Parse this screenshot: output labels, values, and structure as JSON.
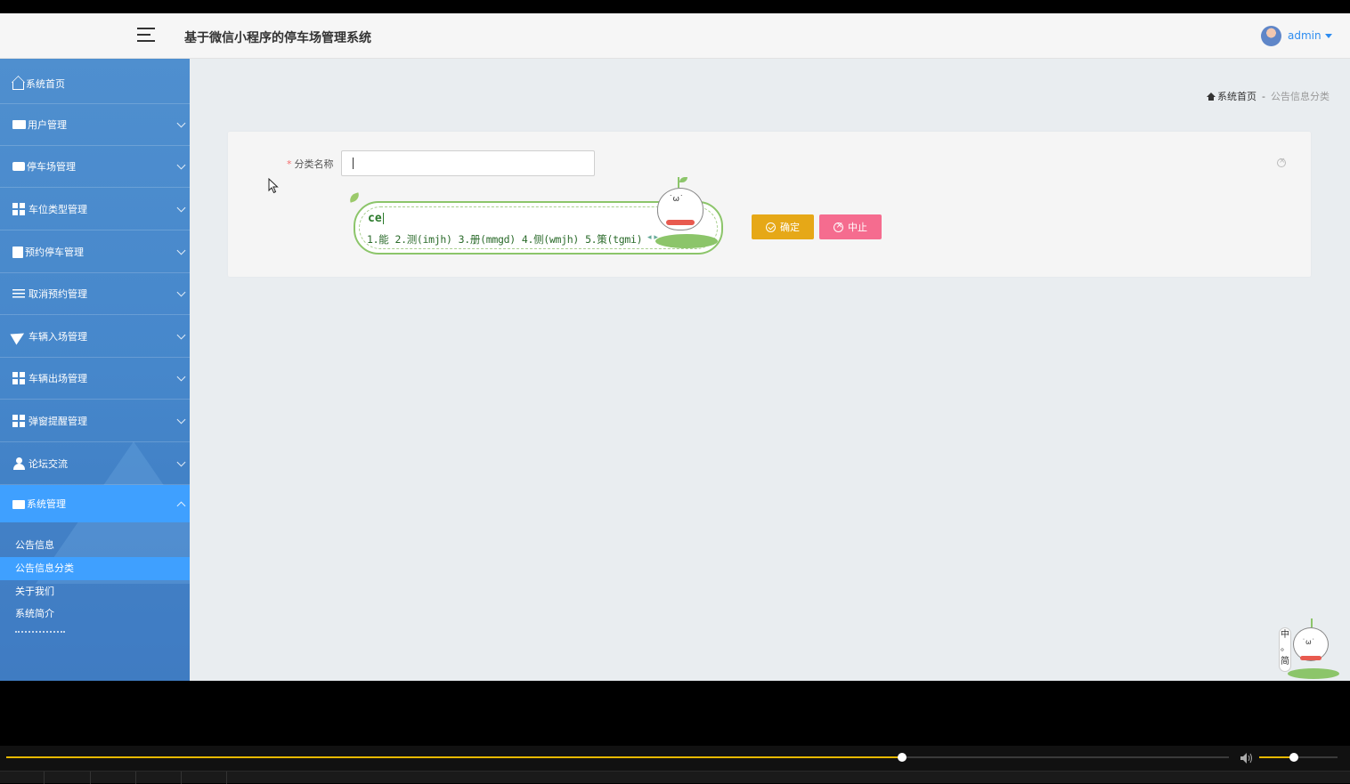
{
  "header": {
    "app_title": "基于微信小程序的停车场管理系统",
    "user_name": "admin"
  },
  "sidebar": {
    "items": [
      {
        "label": "系统首页",
        "icon": "home-icon"
      },
      {
        "label": "用户管理",
        "icon": "ticket-icon"
      },
      {
        "label": "停车场管理",
        "icon": "chat-icon"
      },
      {
        "label": "车位类型管理",
        "icon": "grid-icon"
      },
      {
        "label": "预约停车管理",
        "icon": "clipboard-icon"
      },
      {
        "label": "取消预约管理",
        "icon": "sliders-icon"
      },
      {
        "label": "车辆入场管理",
        "icon": "paper-plane-icon"
      },
      {
        "label": "车辆出场管理",
        "icon": "grid-icon"
      },
      {
        "label": "弹窗提醒管理",
        "icon": "grid-icon"
      },
      {
        "label": "论坛交流",
        "icon": "user-icon"
      },
      {
        "label": "系统管理",
        "icon": "briefcase-icon"
      }
    ],
    "sub_items": [
      "公告信息",
      "公告信息分类",
      "关于我们",
      "系统简介"
    ],
    "active_sub": "公告信息分类"
  },
  "breadcrumb": {
    "home": "系统首页",
    "separator": "-",
    "current": "公告信息分类"
  },
  "form": {
    "required_mark": "*",
    "field_label": "分类名称",
    "field_value": "",
    "ok_label": "确定",
    "stop_label": "中止"
  },
  "ime": {
    "composition": "ce",
    "candidates": [
      "1.能",
      "2.测(imjh)",
      "3.册(mmgd)",
      "4.侧(wmjh)",
      "5.策(tgmi)"
    ]
  },
  "corner_widget": {
    "text": [
      "中",
      "。",
      "简"
    ]
  },
  "player": {
    "progress": 0.7328,
    "volume": 0.44
  },
  "colors": {
    "sidebar": "#4687cb",
    "active": "#3fa0ff",
    "ok_button": "#e6a817",
    "stop_button": "#f56c8f",
    "accent": "#2d8cf0"
  }
}
